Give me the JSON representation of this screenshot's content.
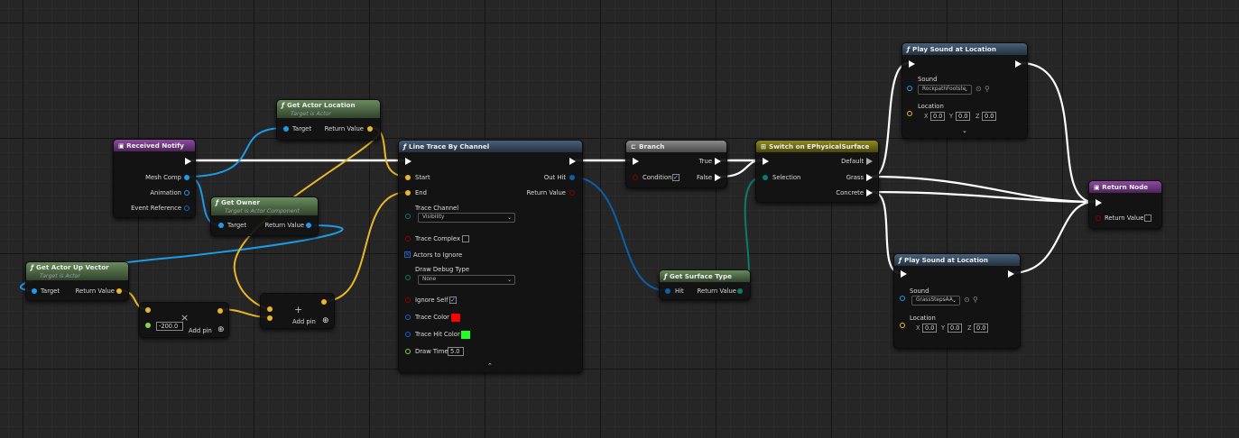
{
  "colors": {
    "exec": "#ffffff",
    "object": "#1e9be6",
    "vector": "#e9b72b",
    "bool": "#8b0000",
    "struct": "#0e5fa8",
    "byte": "#0b7d6b",
    "float": "#8bd14a",
    "trace_color": "#ff0000",
    "trace_hit_color": "#22ff22"
  },
  "received_notify": {
    "title": "Received Notify",
    "pins": [
      "Mesh Comp",
      "Animation",
      "Event Reference"
    ]
  },
  "get_actor_location": {
    "title": "Get Actor Location",
    "subtitle": "Target is Actor",
    "target": "Target",
    "return_value": "Return Value"
  },
  "get_owner": {
    "title": "Get Owner",
    "subtitle": "Target is Actor Component",
    "target": "Target",
    "return_value": "Return Value"
  },
  "get_actor_up_vector": {
    "title": "Get Actor Up Vector",
    "subtitle": "Target is Actor",
    "target": "Target",
    "return_value": "Return Value"
  },
  "multiply": {
    "symbol": "×",
    "value": "-200.0",
    "add_pin": "Add pin",
    "add_icon": "⊕"
  },
  "add": {
    "symbol": "+",
    "add_pin": "Add pin",
    "add_icon": "⊕"
  },
  "line_trace": {
    "title": "Line Trace By Channel",
    "start": "Start",
    "end": "End",
    "out_hit": "Out Hit",
    "return_value": "Return Value",
    "trace_channel": "Trace Channel",
    "trace_channel_value": "Visibility",
    "trace_complex": "Trace Complex",
    "actors_to_ignore": "Actors to Ignore",
    "draw_debug_type": "Draw Debug Type",
    "draw_debug_value": "None",
    "ignore_self": "Ignore Self",
    "trace_color": "Trace Color",
    "trace_hit_color": "Trace Hit Color",
    "draw_time": "Draw Time",
    "draw_time_value": "5.0",
    "collapse": "⌃"
  },
  "branch": {
    "title": "Branch",
    "true": "True",
    "false": "False",
    "condition": "Condition"
  },
  "switch": {
    "title": "Switch on EPhysicalSurface",
    "default": "Default",
    "selection": "Selection",
    "grass": "Grass",
    "concrete": "Concrete"
  },
  "get_surface_type": {
    "title": "Get Surface Type",
    "hit": "Hit",
    "return_value": "Return Value"
  },
  "play_sound_1": {
    "title": "Play Sound at Location",
    "sound": "Sound",
    "sound_value": "RockpathFootste",
    "location": "Location",
    "x": "0.0",
    "y": "0.0",
    "z": "0.0",
    "expand": "⌄"
  },
  "play_sound_2": {
    "title": "Play Sound at Location",
    "sound": "Sound",
    "sound_value": "GrassStepsAA",
    "location": "Location",
    "x": "0.0",
    "y": "0.0",
    "z": "0.0"
  },
  "return_node": {
    "title": "Return Node",
    "return_value": "Return Value"
  },
  "axis": {
    "x": "X",
    "y": "Y",
    "z": "Z"
  },
  "func_glyph": "ƒ"
}
